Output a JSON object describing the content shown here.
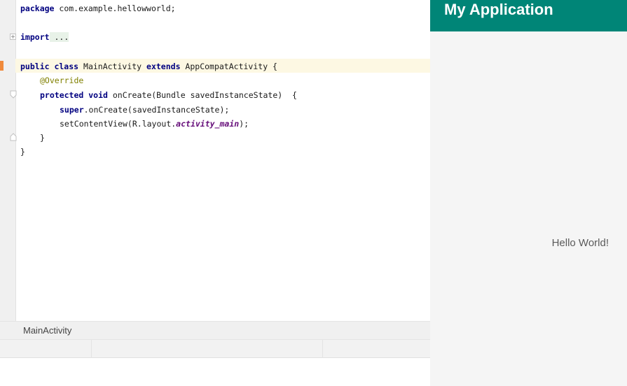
{
  "editor": {
    "lines": {
      "package_kw": "package",
      "package_name": " com.example.hellowworld;",
      "import_kw": "import",
      "import_fold": " ...",
      "class_public": "public class",
      "class_name": " MainActivity ",
      "class_extends": "extends",
      "class_super": " AppCompatActivity {",
      "annotation": "@Override",
      "method_mods": "protected void",
      "method_sig": " onCreate(Bundle savedInstanceState)  {",
      "super_kw": "super",
      "super_call": ".onCreate(savedInstanceState);",
      "set_call": "setContentView(R.layout.",
      "set_field": "activity_main",
      "set_end": ");",
      "method_close": "}",
      "class_close": "}"
    }
  },
  "tabs": {
    "breadcrumb": "MainActivity"
  },
  "preview": {
    "app_title": "My Application",
    "hello_text": "Hello World!",
    "colors": {
      "appbar": "#008577",
      "background": "#f5f5f5"
    }
  }
}
